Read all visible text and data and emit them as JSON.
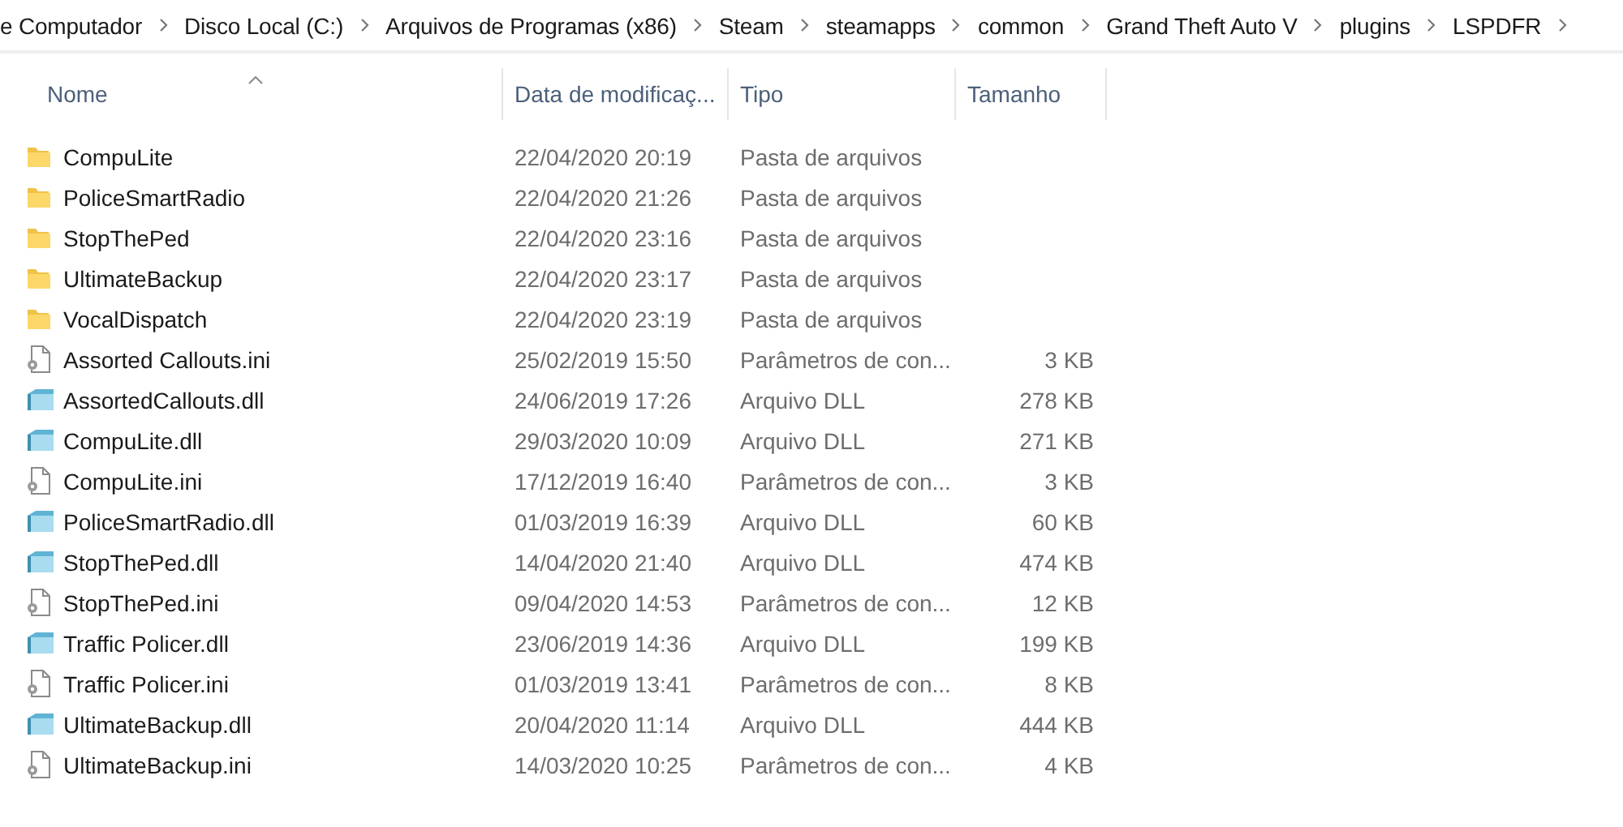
{
  "breadcrumb": [
    "e Computador",
    "Disco Local (C:)",
    "Arquivos de Programas (x86)",
    "Steam",
    "steamapps",
    "common",
    "Grand Theft Auto V",
    "plugins",
    "LSPDFR"
  ],
  "columns": [
    {
      "label": "Nome",
      "sorted": true
    },
    {
      "label": "Data de modificaç...",
      "sorted": false
    },
    {
      "label": "Tipo",
      "sorted": false
    },
    {
      "label": "Tamanho",
      "sorted": false
    }
  ],
  "files": [
    {
      "kind": "folder",
      "name": "CompuLite",
      "modified": "22/04/2020 20:19",
      "type": "Pasta de arquivos"
    },
    {
      "kind": "folder",
      "name": "PoliceSmartRadio",
      "modified": "22/04/2020 21:26",
      "type": "Pasta de arquivos"
    },
    {
      "kind": "folder",
      "name": "StopThePed",
      "modified": "22/04/2020 23:16",
      "type": "Pasta de arquivos"
    },
    {
      "kind": "folder",
      "name": "UltimateBackup",
      "modified": "22/04/2020 23:17",
      "type": "Pasta de arquivos"
    },
    {
      "kind": "folder",
      "name": "VocalDispatch",
      "modified": "22/04/2020 23:19",
      "type": "Pasta de arquivos"
    },
    {
      "kind": "ini",
      "name": "Assorted Callouts.ini",
      "modified": "25/02/2019 15:50",
      "type": "Parâmetros de con...",
      "size": "3 KB"
    },
    {
      "kind": "dll",
      "name": "AssortedCallouts.dll",
      "modified": "24/06/2019 17:26",
      "type": "Arquivo DLL",
      "size": "278 KB"
    },
    {
      "kind": "dll",
      "name": "CompuLite.dll",
      "modified": "29/03/2020 10:09",
      "type": "Arquivo DLL",
      "size": "271 KB"
    },
    {
      "kind": "ini",
      "name": "CompuLite.ini",
      "modified": "17/12/2019 16:40",
      "type": "Parâmetros de con...",
      "size": "3 KB"
    },
    {
      "kind": "dll",
      "name": "PoliceSmartRadio.dll",
      "modified": "01/03/2019 16:39",
      "type": "Arquivo DLL",
      "size": "60 KB"
    },
    {
      "kind": "dll",
      "name": "StopThePed.dll",
      "modified": "14/04/2020 21:40",
      "type": "Arquivo DLL",
      "size": "474 KB"
    },
    {
      "kind": "ini",
      "name": "StopThePed.ini",
      "modified": "09/04/2020 14:53",
      "type": "Parâmetros de con...",
      "size": "12 KB"
    },
    {
      "kind": "dll",
      "name": "Traffic Policer.dll",
      "modified": "23/06/2019 14:36",
      "type": "Arquivo DLL",
      "size": "199 KB"
    },
    {
      "kind": "ini",
      "name": "Traffic Policer.ini",
      "modified": "01/03/2019 13:41",
      "type": "Parâmetros de con...",
      "size": "8 KB"
    },
    {
      "kind": "dll",
      "name": "UltimateBackup.dll",
      "modified": "20/04/2020 11:14",
      "type": "Arquivo DLL",
      "size": "444 KB"
    },
    {
      "kind": "ini",
      "name": "UltimateBackup.ini",
      "modified": "14/03/2020 10:25",
      "type": "Parâmetros de con...",
      "size": "4 KB"
    }
  ]
}
